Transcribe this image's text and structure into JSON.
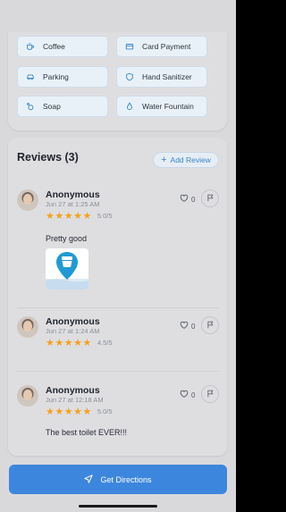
{
  "amenities": [
    {
      "label": "Coffee",
      "icon": "coffee-icon"
    },
    {
      "label": "Card Payment",
      "icon": "card-icon"
    },
    {
      "label": "Parking",
      "icon": "car-icon"
    },
    {
      "label": "Hand Sanitizer",
      "icon": "shield-icon"
    },
    {
      "label": "Soap",
      "icon": "soap-icon"
    },
    {
      "label": "Water Fountain",
      "icon": "water-drop-icon"
    }
  ],
  "reviews_section": {
    "title": "Reviews (3)",
    "add_button": "Add Review"
  },
  "reviews": [
    {
      "name": "Anonymous",
      "date": "Jun 27 at 1:25 AM",
      "stars": "★★★★★",
      "score": "5.0/5",
      "likes": "0",
      "comment": "Pretty good",
      "has_photo": true
    },
    {
      "name": "Anonymous",
      "date": "Jun 27 at 1:24 AM",
      "stars": "★★★★★",
      "score": "4.5/5",
      "likes": "0",
      "comment": "",
      "has_photo": false
    },
    {
      "name": "Anonymous",
      "date": "Jun 27 at 12:18 AM",
      "stars": "★★★★★",
      "score": "5.0/5",
      "likes": "0",
      "comment": "The best toilet EVER!!!",
      "has_photo": false
    }
  ],
  "directions_button": "Get Directions",
  "colors": {
    "accent": "#3d86dd",
    "star": "#f4a21c",
    "chip_bg": "#e9f1f8"
  }
}
